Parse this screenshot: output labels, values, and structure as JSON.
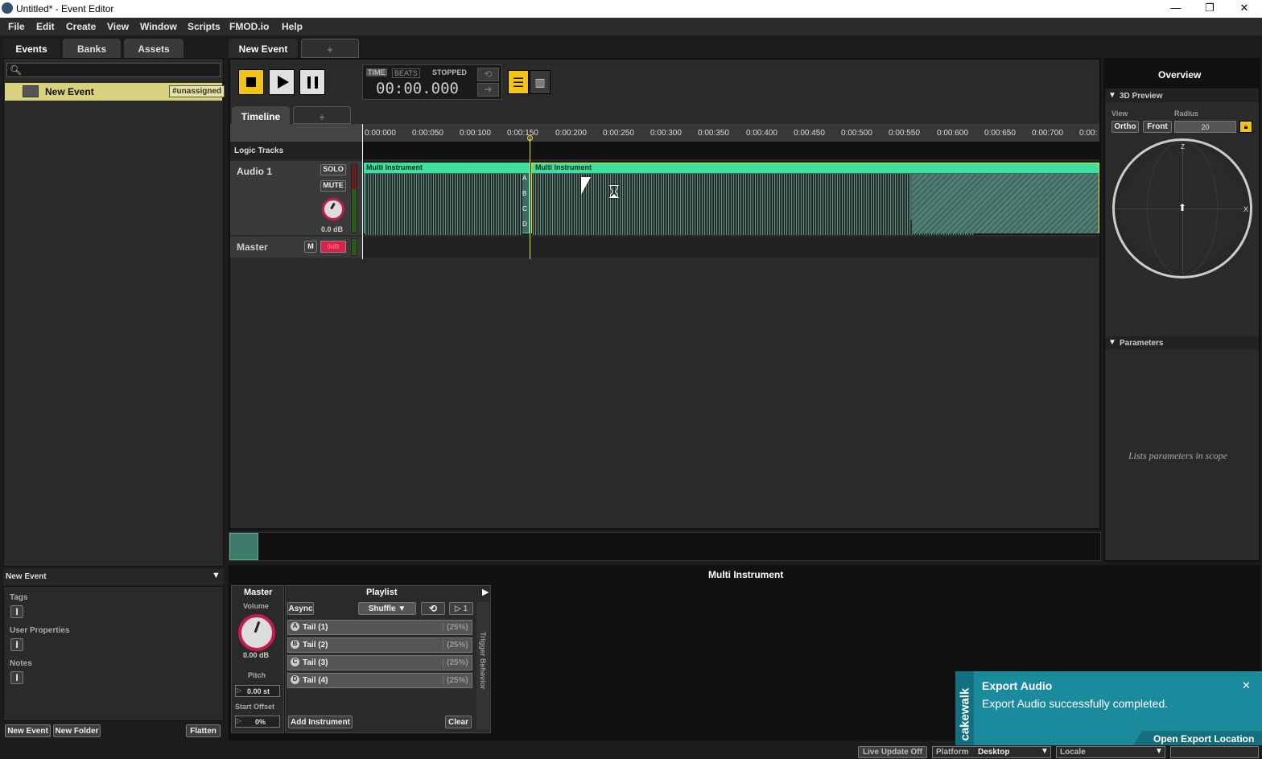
{
  "window": {
    "title": "Untitled* - Event Editor",
    "minimize": "—",
    "restore": "❐",
    "close": "✕"
  },
  "menu": [
    "File",
    "Edit",
    "Create",
    "View",
    "Window",
    "Scripts",
    "FMOD.io",
    "Help"
  ],
  "left": {
    "tabs": [
      "Events",
      "Banks",
      "Assets"
    ],
    "search_placeholder": "",
    "event_item": {
      "label": "New Event",
      "bank_badge": "#unassigned"
    },
    "props_header": "New Event",
    "tags_label": "Tags",
    "user_props_label": "User Properties",
    "notes_label": "Notes",
    "new_event": "New Event",
    "new_folder": "New Folder",
    "flatten": "Flatten"
  },
  "editor": {
    "tab": "New Event",
    "add_tab": "+",
    "time_label": "TIME",
    "beats_label": "BEATS",
    "state": "STOPPED",
    "time": "00:00.000",
    "sub_tab": "Timeline",
    "sub_add": "+",
    "logic_tracks": "Logic Tracks",
    "ruler": [
      "0:00:000",
      "0:00:050",
      "0:00:100",
      "0:00:150",
      "0:00:200",
      "0:00:250",
      "0:00:300",
      "0:00:350",
      "0:00:400",
      "0:00:450",
      "0:00:500",
      "0:00:550",
      "0:00:600",
      "0:00:650",
      "0:00:700",
      "0:00:"
    ],
    "track": {
      "name": "Audio 1",
      "solo": "SOLO",
      "mute": "MUTE",
      "volume": "0.0 dB"
    },
    "master": {
      "name": "Master",
      "m": "M",
      "meter": "0dB"
    },
    "regions": [
      "Multi Instrument",
      "Multi Instrument"
    ],
    "lanes": [
      "A",
      "B",
      "C",
      "D"
    ]
  },
  "overview": {
    "title": "Overview",
    "preview": "3D Preview",
    "view_label": "View",
    "radius_label": "Radius",
    "ortho": "Ortho",
    "front": "Front",
    "radius": "20",
    "axis_z": "Z",
    "axis_x": "X",
    "parameters": "Parameters",
    "params_hint": "Lists parameters in scope"
  },
  "deck": {
    "title": "Multi Instrument",
    "master": "Master",
    "volume_label": "Volume",
    "volume": "0.00 dB",
    "pitch_label": "Pitch",
    "pitch": "0.00 st",
    "offset_label": "Start Offset",
    "offset": "0%",
    "playlist": "Playlist",
    "async": "Async",
    "shuffle": "Shuffle",
    "count": "1",
    "items": [
      {
        "key": "A",
        "name": "Tail (1)",
        "pct": "(25%)"
      },
      {
        "key": "B",
        "name": "Tail (2)",
        "pct": "(25%)"
      },
      {
        "key": "C",
        "name": "Tail (3)",
        "pct": "(25%)"
      },
      {
        "key": "D",
        "name": "Tail (4)",
        "pct": "(25%)"
      }
    ],
    "add_instrument": "Add Instrument",
    "clear": "Clear",
    "trigger": "Trigger Behavior"
  },
  "toast": {
    "brand": "cakewalk",
    "title": "Export Audio",
    "message": "Export Audio successfully completed.",
    "link": "Open Export Location",
    "close": "✕"
  },
  "status": {
    "live_update": "Live Update Off",
    "platform_label": "Platform",
    "platform": "Desktop",
    "locale_label": "Locale"
  },
  "colors": {
    "accent": "#f2c417",
    "region": "#3de09e",
    "region_body": "#3f6b61",
    "toast": "#1b8a9c"
  }
}
